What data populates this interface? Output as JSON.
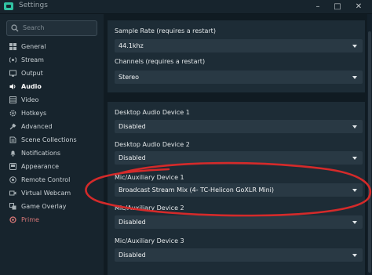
{
  "window": {
    "title": "Settings",
    "controls": [
      "–",
      "□",
      "✕"
    ]
  },
  "colors": {
    "accent": "#31c3a2",
    "annotation": "#d42a2a",
    "prime": "#d87777"
  },
  "sidebar": {
    "search_placeholder": "Search",
    "items": [
      {
        "label": "General",
        "icon": "gear-icon"
      },
      {
        "label": "Stream",
        "icon": "broadcast-icon"
      },
      {
        "label": "Output",
        "icon": "output-icon"
      },
      {
        "label": "Audio",
        "icon": "speaker-icon",
        "active": true
      },
      {
        "label": "Video",
        "icon": "video-icon"
      },
      {
        "label": "Hotkeys",
        "icon": "keyboard-icon"
      },
      {
        "label": "Advanced",
        "icon": "tools-icon"
      },
      {
        "label": "Scene Collections",
        "icon": "scenes-icon"
      },
      {
        "label": "Notifications",
        "icon": "bell-icon"
      },
      {
        "label": "Appearance",
        "icon": "palette-icon"
      },
      {
        "label": "Remote Control",
        "icon": "remote-icon"
      },
      {
        "label": "Virtual Webcam",
        "icon": "webcam-icon"
      },
      {
        "label": "Game Overlay",
        "icon": "overlay-icon"
      },
      {
        "label": "Prime",
        "icon": "prime-icon"
      }
    ]
  },
  "audio": {
    "sample_rate": {
      "label": "Sample Rate (requires a restart)",
      "value": "44.1khz"
    },
    "channels": {
      "label": "Channels (requires a restart)",
      "value": "Stereo"
    },
    "desktop_1": {
      "label": "Desktop Audio Device 1",
      "value": "Disabled"
    },
    "desktop_2": {
      "label": "Desktop Audio Device 2",
      "value": "Disabled"
    },
    "mic_1": {
      "label": "Mic/Auxiliary Device 1",
      "value": "Broadcast Stream Mix (4- TC-Helicon GoXLR Mini)"
    },
    "mic_2": {
      "label": "Mic/Auxiliary Device 2",
      "value": "Disabled"
    },
    "mic_3": {
      "label": "Mic/Auxiliary Device 3",
      "value": "Disabled"
    }
  }
}
